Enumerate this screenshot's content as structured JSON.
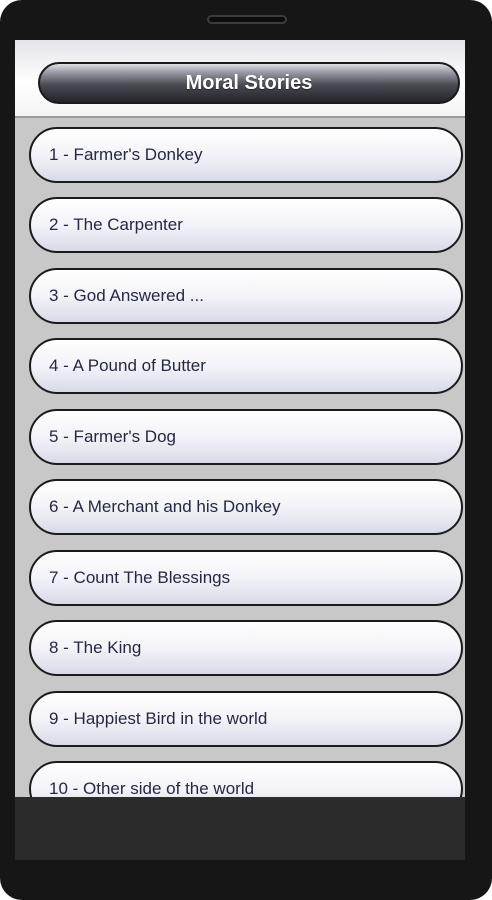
{
  "app": {
    "title": "Moral Stories"
  },
  "stories": [
    {
      "label": "1 - Farmer's Donkey"
    },
    {
      "label": "2 - The Carpenter"
    },
    {
      "label": "3 - God Answered ..."
    },
    {
      "label": "4 - A Pound of Butter"
    },
    {
      "label": "5 - Farmer's Dog"
    },
    {
      "label": "6 - A Merchant and his Donkey"
    },
    {
      "label": "7 - Count The Blessings"
    },
    {
      "label": "8 - The King"
    },
    {
      "label": "9 - Happiest Bird in the world"
    },
    {
      "label": "10 - Other side of the world"
    }
  ],
  "colors": {
    "device_frame": "#161616",
    "list_background": "#c8c8c8",
    "item_text": "#262842",
    "title_text": "#ffffff"
  }
}
